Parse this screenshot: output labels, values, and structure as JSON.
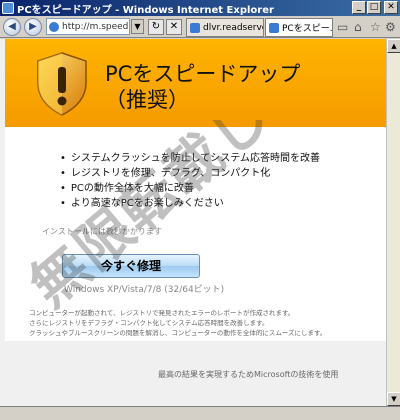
{
  "window": {
    "title": "PCをスピードアップ - Windows Internet Explorer",
    "min_label": "_",
    "max_label": "□",
    "close_label": "✕"
  },
  "toolbar": {
    "address": "http://m.speed...",
    "tabs": [
      {
        "label": "dlvr.readserve...",
        "active": false
      },
      {
        "label": "PCをスピー...",
        "active": true
      }
    ]
  },
  "banner": {
    "title_line1": "PCをスピードアップ",
    "title_line2": "（推奨）",
    "accent_color": "#ffab00"
  },
  "features": [
    "システムクラッシュを防止してシステム応答時間を改善",
    "レジストリを修理、デフラグ、コンパクト化",
    "PCの動作全体を大幅に改善",
    "より高速なPCをお楽しみください"
  ],
  "install_note": "インストールには数秒かかります",
  "cta_label": "今すぐ修理",
  "compatibility": "Windows XP/Vista/7/8 (32/64ビット)",
  "disclaimer_lines": [
    "コンピューターが起動されて、レジストリで発見されたエラーのレポートが作成されます。",
    "さらにレジストリをデフラグ・コンパクト化してシステム応答時間を改善します。",
    "クラッシュやブルースクリーンの問題を解消し、コンピューターの動作を全体的にスムーズにします。"
  ],
  "footer": "最高の結果を実現するためMicrosoftの技術を使用",
  "watermark": "無限転載しロク"
}
